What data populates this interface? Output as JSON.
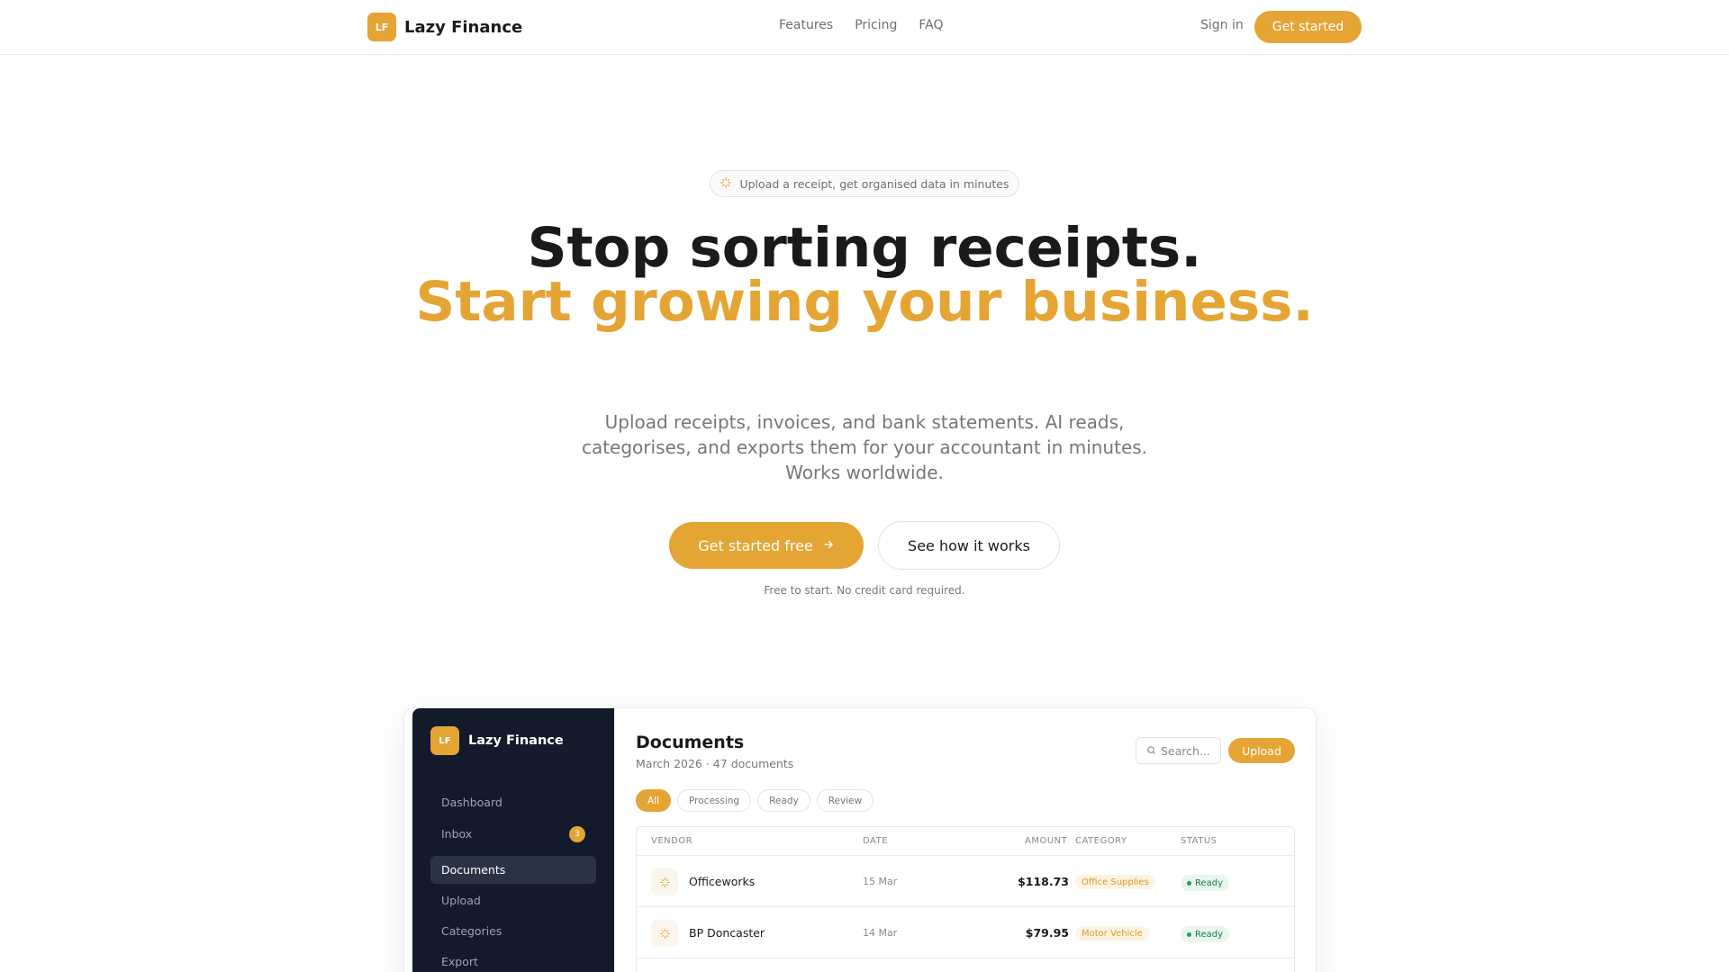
{
  "nav": {
    "brand_logo": "LF",
    "brand_name": "Lazy Finance",
    "links": [
      "Features",
      "Pricing",
      "FAQ"
    ],
    "signin": "Sign in",
    "cta": "Get started"
  },
  "hero": {
    "pill": "Upload a receipt, get organised data in minutes",
    "title_line1": "Stop sorting receipts.",
    "title_accent": "Start growing your business.",
    "subtitle": "Upload receipts, invoices, and bank statements. AI reads, categorises, and exports them for your accountant in minutes. Works worldwide.",
    "primary_cta": "Get started free",
    "secondary_cta": "See how it works",
    "fineprint": "Free to start. No credit card required."
  },
  "app": {
    "logo": "LF",
    "name": "Lazy Finance",
    "sidebar": [
      {
        "label": "Dashboard"
      },
      {
        "label": "Inbox",
        "badge": "3"
      },
      {
        "label": "Documents",
        "active": true
      },
      {
        "label": "Upload"
      },
      {
        "label": "Categories"
      },
      {
        "label": "Export"
      }
    ],
    "title": "Documents",
    "subtitle": "March 2026 · 47 documents",
    "search_placeholder": "Search...",
    "upload": "Upload",
    "filters": [
      "All",
      "Processing",
      "Ready",
      "Review"
    ],
    "columns": {
      "vendor": "VENDOR",
      "date": "DATE",
      "amount": "AMOUNT",
      "category": "CATEGORY",
      "status": "STATUS"
    },
    "rows": [
      {
        "vendor": "Officeworks",
        "date": "15 Mar",
        "amount": "$118.73",
        "category": "Office Supplies",
        "status": "Ready"
      },
      {
        "vendor": "BP Doncaster",
        "date": "14 Mar",
        "amount": "$79.95",
        "category": "Motor Vehicle",
        "status": "Ready"
      }
    ]
  },
  "colors": {
    "accent": "#e4a535",
    "sidebar": "#121a2b",
    "success": "#1e7a46"
  },
  "icons": [
    "sparkle-icon",
    "arrow-right-icon",
    "search-icon"
  ]
}
